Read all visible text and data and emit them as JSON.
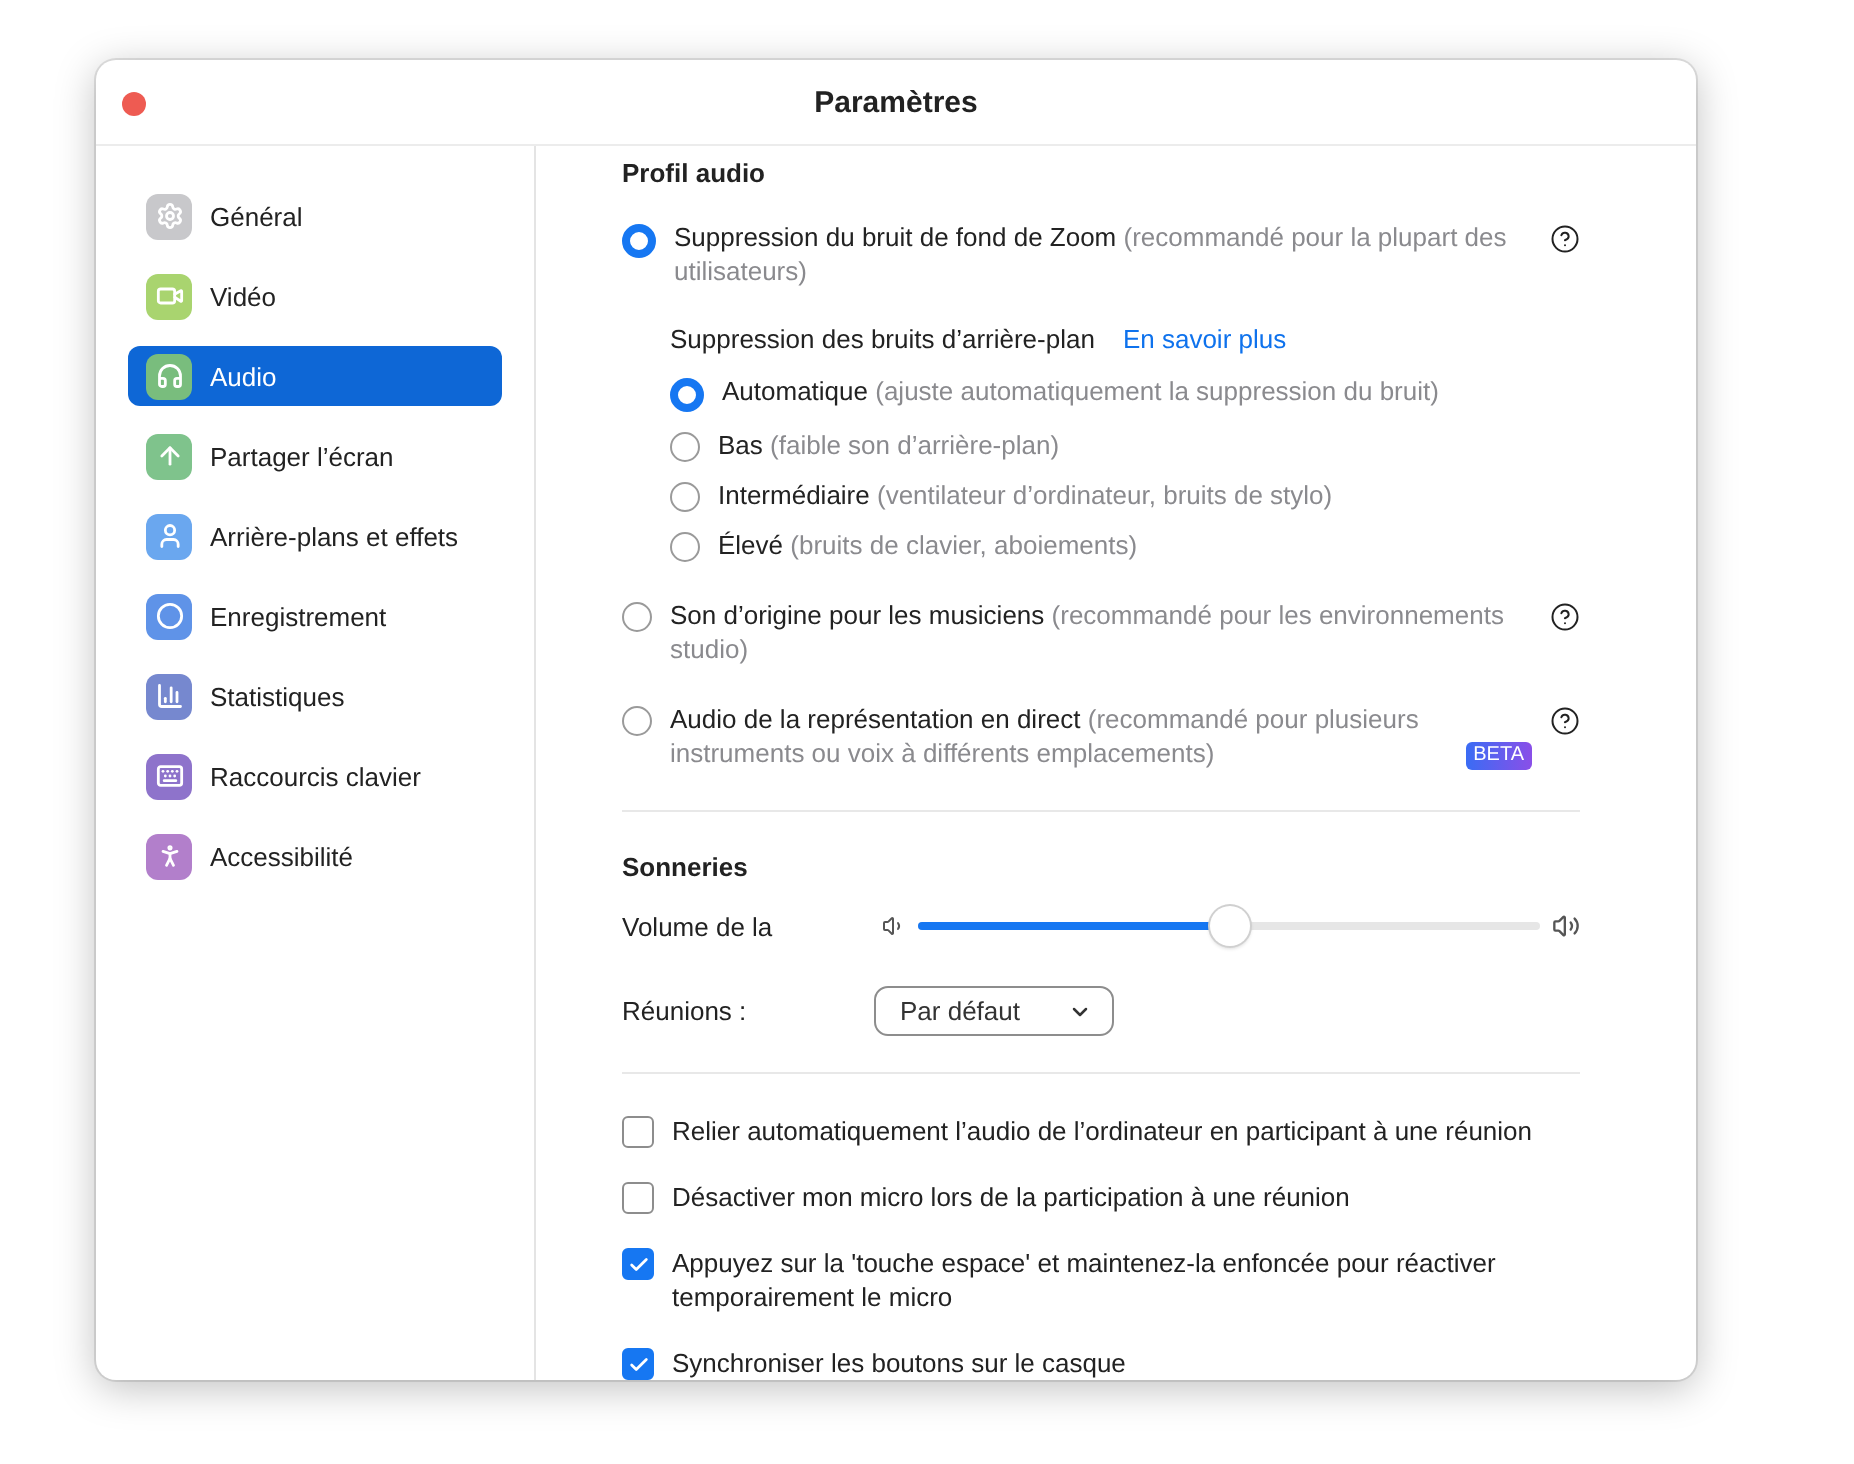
{
  "window": {
    "title": "Paramètres"
  },
  "sidebar": {
    "items": [
      {
        "label": "Général",
        "selected": false
      },
      {
        "label": "Vidéo",
        "selected": false
      },
      {
        "label": "Audio",
        "selected": true
      },
      {
        "label": "Partager l’écran",
        "selected": false
      },
      {
        "label": "Arrière-plans et effets",
        "selected": false
      },
      {
        "label": "Enregistrement",
        "selected": false
      },
      {
        "label": "Statistiques",
        "selected": false
      },
      {
        "label": "Raccourcis clavier",
        "selected": false
      },
      {
        "label": "Accessibilité",
        "selected": false
      }
    ]
  },
  "profile": {
    "heading": "Profil audio",
    "options": [
      {
        "label": "Suppression du bruit de fond de Zoom",
        "hint": "(recommandé pour la plupart des utilisateurs)",
        "selected": true,
        "sub": {
          "title": "Suppression des bruits d’arrière-plan",
          "link": "En savoir plus",
          "levels": [
            {
              "label": "Automatique",
              "hint": "(ajuste automatiquement la suppression du bruit)",
              "selected": true
            },
            {
              "label": "Bas",
              "hint": "(faible son d’arrière-plan)",
              "selected": false
            },
            {
              "label": "Intermédiaire",
              "hint": "(ventilateur d’ordinateur, bruits de stylo)",
              "selected": false
            },
            {
              "label": "Élevé",
              "hint": "(bruits de clavier, aboiements)",
              "selected": false
            }
          ]
        }
      },
      {
        "label": "Son d’origine pour les musiciens",
        "hint": "(recommandé pour les environnements studio)",
        "selected": false
      },
      {
        "label": "Audio de la représentation en direct",
        "hint": "(recommandé pour plusieurs instruments ou voix à différents emplacements)",
        "badge": "BETA",
        "selected": false
      }
    ]
  },
  "ringtones": {
    "heading": "Sonneries",
    "volume_label": "Volume de la",
    "volume": {
      "level": 0.5
    },
    "meetings_label": "Réunions :",
    "meetings_value": "Par défaut"
  },
  "checkboxes": [
    {
      "label": "Relier automatiquement l’audio de l’ordinateur en participant à une réunion",
      "checked": false
    },
    {
      "label": "Désactiver mon micro lors de la participation à une réunion",
      "checked": false
    },
    {
      "label": "Appuyez sur la 'touche espace' et maintenez-la enfoncée pour réactiver temporairement le micro",
      "checked": true
    },
    {
      "label": "Synchroniser les boutons sur le casque",
      "checked": true
    }
  ]
}
